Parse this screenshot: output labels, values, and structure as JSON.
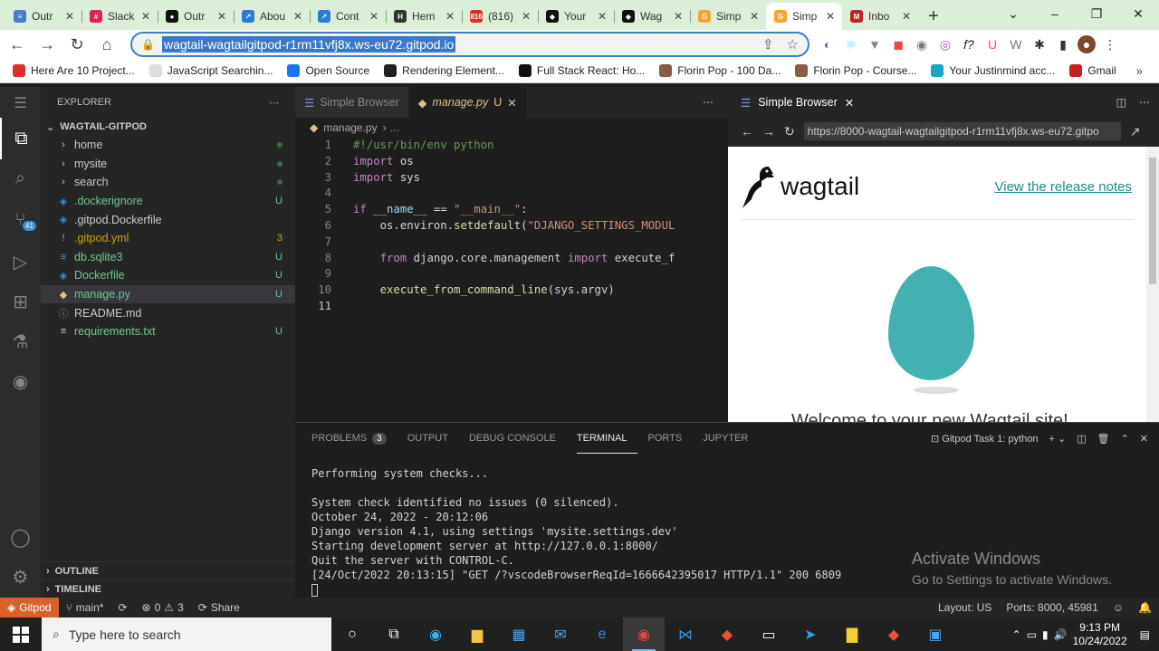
{
  "browser": {
    "tabs": [
      {
        "label": "Outr",
        "color": "#4a7bd0",
        "glyph": "≡"
      },
      {
        "label": "Slack",
        "color": "#e01e5a",
        "glyph": "#"
      },
      {
        "label": "Outr",
        "color": "#111111",
        "glyph": "●"
      },
      {
        "label": "Abou",
        "color": "#2b7bd8",
        "glyph": "↗"
      },
      {
        "label": "Cont",
        "color": "#2b7bd8",
        "glyph": "↗"
      },
      {
        "label": "Hem",
        "color": "#333333",
        "glyph": "H"
      },
      {
        "label": "(816)",
        "color": "#d93025",
        "glyph": "816"
      },
      {
        "label": "Your",
        "color": "#111111",
        "glyph": "◆"
      },
      {
        "label": "Wag",
        "color": "#111111",
        "glyph": "◆"
      },
      {
        "label": "Simp",
        "color": "#f4a52b",
        "glyph": "G"
      },
      {
        "label": "Simp",
        "color": "#f4a52b",
        "glyph": "G"
      },
      {
        "label": "Inbo",
        "color": "#c5221f",
        "glyph": "M"
      }
    ],
    "active_tab": 10,
    "url": "wagtail-wagtailgitpod-r1rm11vfj8x.ws-eu72.gitpod.io",
    "bookmarks": [
      {
        "label": "Here Are 10 Project...",
        "color": "#d93025"
      },
      {
        "label": "JavaScript Searchin...",
        "color": "#dddddd"
      },
      {
        "label": "Open Source",
        "color": "#1877f2"
      },
      {
        "label": "Rendering Element...",
        "color": "#222222"
      },
      {
        "label": "Full Stack React: Ho...",
        "color": "#111111"
      },
      {
        "label": "Florin Pop - 100 Da...",
        "color": "#8a5a44"
      },
      {
        "label": "Florin Pop - Course...",
        "color": "#8a5a44"
      },
      {
        "label": "Your Justinmind acc...",
        "color": "#1aa3c7"
      },
      {
        "label": "Gmail",
        "color": "#c5221f"
      }
    ]
  },
  "explorer": {
    "header": "EXPLORER",
    "project": "WAGTAIL-GITPOD",
    "items": [
      {
        "name": "home",
        "type": "folder",
        "status": "dot",
        "color": "#cccccc"
      },
      {
        "name": "mysite",
        "type": "folder",
        "status": "dot",
        "color": "#cccccc"
      },
      {
        "name": "search",
        "type": "folder",
        "status": "dot",
        "color": "#cccccc"
      },
      {
        "name": ".dockerignore",
        "type": "docker",
        "status": "U",
        "color": "#73c991"
      },
      {
        "name": ".gitpod.Dockerfile",
        "type": "docker",
        "status": "",
        "color": "#cccccc"
      },
      {
        "name": ".gitpod.yml",
        "type": "yml",
        "status": "3",
        "color": "#cca700"
      },
      {
        "name": "db.sqlite3",
        "type": "db",
        "status": "U",
        "color": "#73c991"
      },
      {
        "name": "Dockerfile",
        "type": "docker",
        "status": "U",
        "color": "#73c991"
      },
      {
        "name": "manage.py",
        "type": "py",
        "status": "U",
        "color": "#73c991"
      },
      {
        "name": "README.md",
        "type": "md",
        "status": "",
        "color": "#cccccc"
      },
      {
        "name": "requirements.txt",
        "type": "txt",
        "status": "U",
        "color": "#73c991"
      }
    ],
    "selected": 8,
    "outline": "OUTLINE",
    "timeline": "TIMELINE"
  },
  "editor": {
    "tabs": [
      {
        "label": "Simple Browser",
        "status": ""
      },
      {
        "label": "manage.py",
        "status": "U"
      }
    ],
    "breadcrumb": "manage.py",
    "current_line": 11
  },
  "simple_browser": {
    "tab_label": "Simple Browser",
    "url": "https://8000-wagtail-wagtailgitpod-r1rm11vfj8x.ws-eu72.gitpo",
    "logo_text": "wagtail",
    "release_link": "View the release notes",
    "welcome": "Welcome to your new Wagtail site!"
  },
  "panel": {
    "tabs": [
      "PROBLEMS",
      "OUTPUT",
      "DEBUG CONSOLE",
      "TERMINAL",
      "PORTS",
      "JUPYTER"
    ],
    "problems_count": "3",
    "active": 3,
    "terminal_name": "Gitpod Task 1: python",
    "terminal_lines": [
      "Performing system checks...",
      "",
      "System check identified no issues (0 silenced).",
      "October 24, 2022 - 20:12:06",
      "Django version 4.1, using settings 'mysite.settings.dev'",
      "Starting development server at http://127.0.0.1:8000/",
      "Quit the server with CONTROL-C.",
      "[24/Oct/2022 20:13:15] \"GET /?vscodeBrowserReqId=1666642395017 HTTP/1.1\" 200 6809"
    ],
    "activate_title": "Activate Windows",
    "activate_sub": "Go to Settings to activate Windows."
  },
  "statusbar": {
    "gitpod": "Gitpod",
    "branch": "main*",
    "errors": "0",
    "warnings": "3",
    "share": "Share",
    "layout": "Layout: US",
    "ports": "Ports: 8000, 45981"
  },
  "taskbar": {
    "search_placeholder": "Type here to search",
    "time": "9:13 PM",
    "date": "10/24/2022"
  }
}
